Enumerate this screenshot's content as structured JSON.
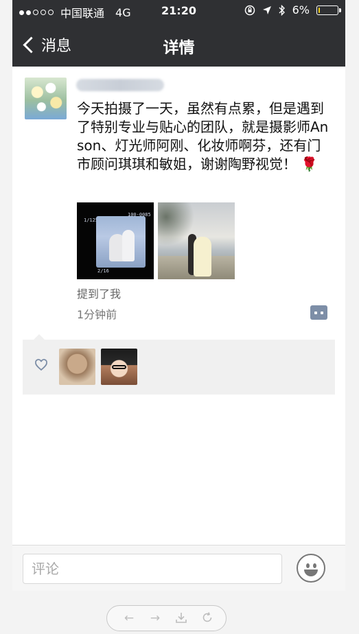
{
  "status_bar": {
    "carrier": "中国联通",
    "network": "4G",
    "time": "21:20",
    "battery_percent": "6%",
    "battery_level": 0.06
  },
  "nav": {
    "back_label": "消息",
    "title": "详情"
  },
  "post": {
    "text": "今天拍摄了一天，虽然有点累，但是遇到了特别专业与贴心的团队，就是摄影师Anson、灯光师阿刚、化妆师啊芬，还有门市顾问琪琪和敏姐，谢谢陶野视觉！",
    "emoji": "🌹",
    "photo1_overlay": [
      "1/125   13",
      "100-0085",
      "2/16"
    ],
    "mention": "提到了我",
    "time_ago": "1分钟前"
  },
  "comment_bar": {
    "placeholder": "评论"
  },
  "toolbar": {
    "icons": [
      "back-arrow-icon",
      "forward-arrow-icon",
      "download-icon",
      "refresh-icon"
    ]
  },
  "colors": {
    "header_bg": "#2f3033",
    "battery_fill": "#f5d11a",
    "comment_button": "#7d8ea7",
    "likes_bg": "#f0f0f0"
  }
}
